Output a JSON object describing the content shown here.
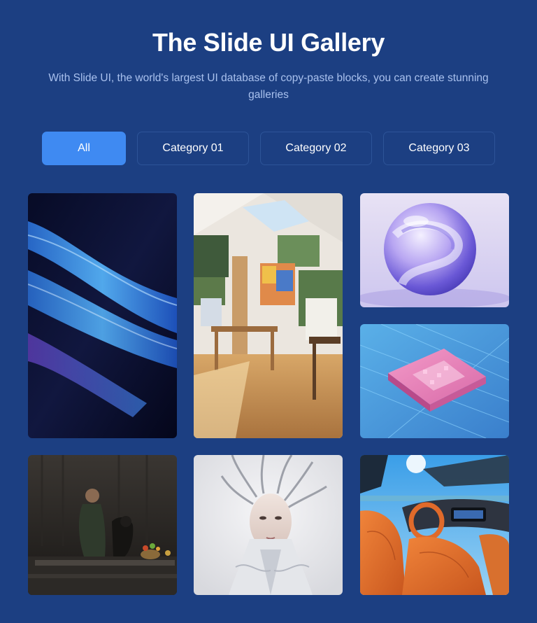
{
  "header": {
    "title": "The Slide UI Gallery",
    "subtitle": "With Slide UI, the world's largest UI database of copy-paste blocks, you can create stunning galleries"
  },
  "filters": {
    "active": "All",
    "items": [
      {
        "label": "All"
      },
      {
        "label": "Category 01"
      },
      {
        "label": "Category 02"
      },
      {
        "label": "Category 03"
      }
    ]
  },
  "colors": {
    "background": "#1c3f82",
    "accent": "#3f8af2",
    "subtitle": "#a9c1ee",
    "button_border": "#2d5498"
  },
  "gallery": {
    "images": [
      {
        "name": "abstract-blue-waves-image"
      },
      {
        "name": "art-studio-interior-image"
      },
      {
        "name": "glass-sphere-image"
      },
      {
        "name": "circuit-chip-image"
      },
      {
        "name": "man-with-dog-image"
      },
      {
        "name": "robot-woman-image"
      },
      {
        "name": "car-interior-image"
      }
    ]
  }
}
